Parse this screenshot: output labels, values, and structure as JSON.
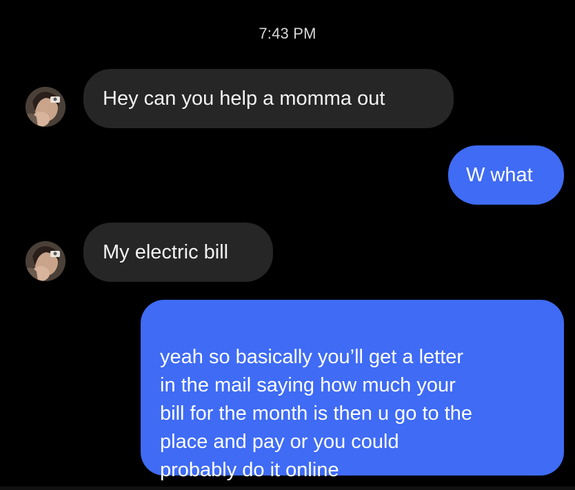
{
  "conversation": {
    "timestamp": "7:43 PM",
    "messages": [
      {
        "direction": "incoming",
        "text": "Hey can you help a momma out"
      },
      {
        "direction": "outgoing",
        "text": "W what"
      },
      {
        "direction": "incoming",
        "text": "My electric bill"
      },
      {
        "direction": "outgoing",
        "text": "yeah so basically you’ll get a letter\nin the mail saying how much your\nbill for the month is then u go to the\nplace and pay or you could\nprobably do it online"
      }
    ]
  },
  "colors": {
    "background": "#000000",
    "incoming_bubble": "#262626",
    "outgoing_bubble": "#3f6bf5",
    "timestamp_text": "#d8d8d8"
  },
  "icons": {
    "avatar": "profile-photo-avatar"
  }
}
